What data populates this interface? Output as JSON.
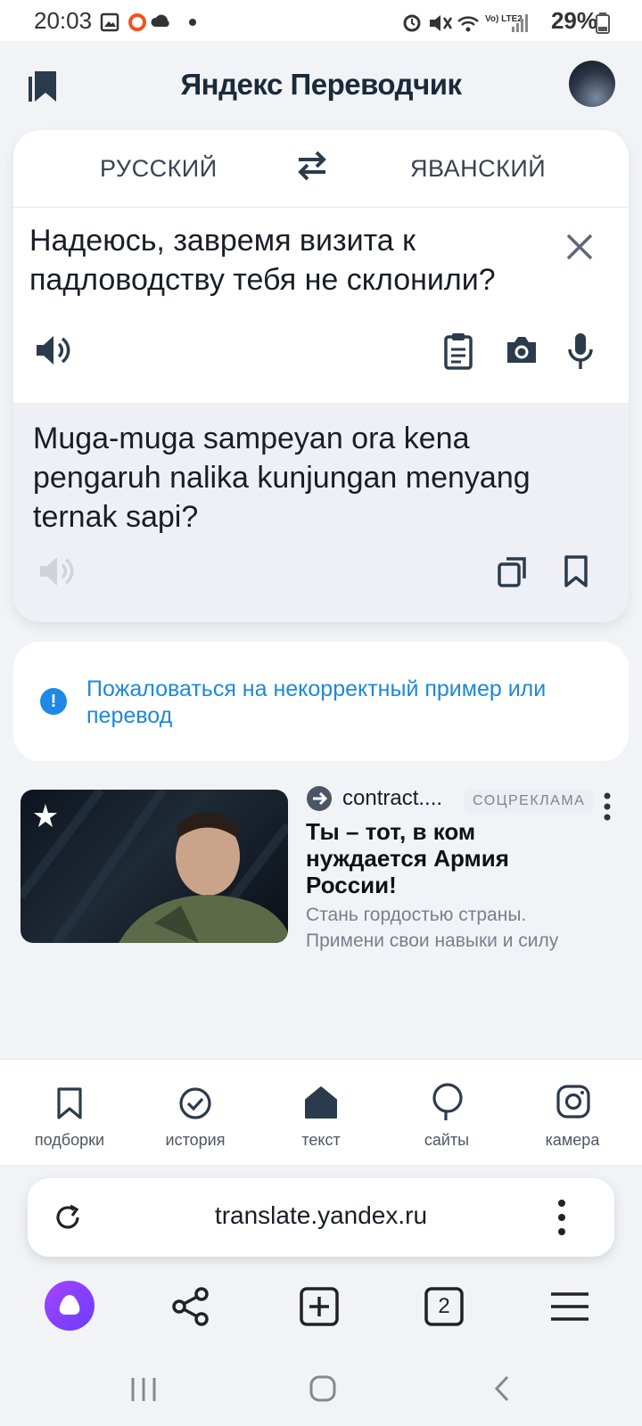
{
  "status_bar": {
    "time": "20:03",
    "battery": "29%",
    "network": "Vo) LTE2"
  },
  "header": {
    "title": "Яндекс Переводчик"
  },
  "translator": {
    "source_lang": "РУССКИЙ",
    "target_lang": "ЯВАНСКИЙ",
    "source_text": "Надеюсь, завремя визита к падловодству тебя не склонили?",
    "target_text": "Muga-muga sampeyan ora kena pengaruh nalika kunjungan menyang ternak sapi?"
  },
  "report": {
    "info_glyph": "!",
    "link_text": "Пожаловаться на некорректный пример или перевод"
  },
  "ad": {
    "source": "contract....",
    "badge": "СОЦРЕКЛАМА",
    "title": "Ты – тот, в ком нуждается Армия России!",
    "description": "Стань гордостью страны. Примени свои навыки и силу"
  },
  "tabs": [
    {
      "label": "подборки",
      "icon": "bookmark-icon"
    },
    {
      "label": "история",
      "icon": "history-icon"
    },
    {
      "label": "текст",
      "icon": "home-icon"
    },
    {
      "label": "сайты",
      "icon": "speech-bubble-icon"
    },
    {
      "label": "камера",
      "icon": "camera-icon"
    }
  ],
  "browser": {
    "url": "translate.yandex.ru",
    "tab_count": "2"
  },
  "colors": {
    "accent_blue": "#1e88d9",
    "alice_purple": "#8b45ff",
    "title_dark": "#1b2a3a"
  }
}
